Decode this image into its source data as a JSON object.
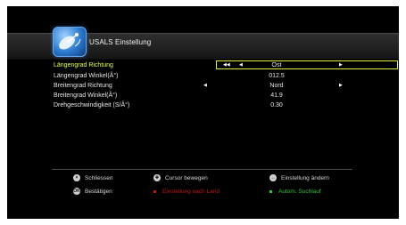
{
  "header": {
    "title": "USALS Einstellung",
    "logo_icon": "satellite-dish-icon"
  },
  "settings": [
    {
      "label": "Längengrad Richtung",
      "value": "Ost",
      "selected": true,
      "has_arrows": true
    },
    {
      "label": "Längengrad Winkel(Â°)",
      "value": "012.5",
      "selected": false,
      "has_arrows": false
    },
    {
      "label": "Breitengrad Richtung",
      "value": "Nord",
      "selected": false,
      "has_arrows": true
    },
    {
      "label": "Breitengrad Winkel(Â°)",
      "value": "41.9",
      "selected": false,
      "has_arrows": false
    },
    {
      "label": "Drehgeschwindigkeit (S/Â°)",
      "value": "0.30",
      "selected": false,
      "has_arrows": false
    }
  ],
  "legend": {
    "close": {
      "label": "Schliessen",
      "icon": "exit-button-icon"
    },
    "cursor": {
      "label": "Cursor bewegen",
      "icon": "dpad-icon"
    },
    "change": {
      "label": "Einstellung ändern",
      "icon": "left-right-button-icon"
    },
    "confirm": {
      "label": "Bestätigen",
      "icon": "ok-button-icon"
    },
    "red": {
      "label": "Einstellung nach Land",
      "color": "#c21616"
    },
    "green": {
      "label": "Autom. Suchlauf",
      "color": "#36c23a"
    }
  }
}
